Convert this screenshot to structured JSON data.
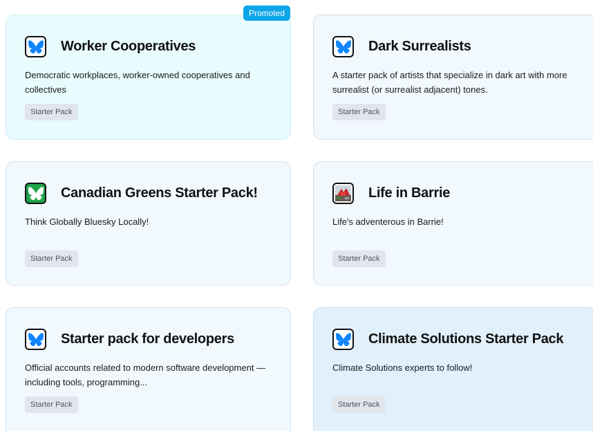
{
  "cards": [
    {
      "title": "Worker Cooperatives",
      "description": "Democratic workplaces, worker-owned cooperatives and collectives",
      "badge": "Starter Pack",
      "promoted_label": "Promoted",
      "icon": "butterfly-icon"
    },
    {
      "title": "Dark Surrealists",
      "description": "A starter pack of artists that specialize in dark art with more surrealist (or surrealist adjacent) tones.",
      "badge": "Starter Pack",
      "icon": "butterfly-icon"
    },
    {
      "title": "Canadian Greens Starter Pack!",
      "description": "Think Globally Bluesky Locally!",
      "badge": "Starter Pack",
      "icon": "green-butterfly-icon"
    },
    {
      "title": "Life in Barrie",
      "description": "Life's adventerous in Barrie!",
      "badge": "Starter Pack",
      "icon": "photo-avatar-icon"
    },
    {
      "title": "Starter pack for developers",
      "description": "Official accounts related to modern software development — including tools, programming...",
      "badge": "Starter Pack",
      "icon": "butterfly-icon"
    },
    {
      "title": "Climate Solutions Starter Pack",
      "description": "Climate Solutions experts to follow!",
      "badge": "Starter Pack",
      "icon": "butterfly-icon"
    }
  ],
  "colors": {
    "butterfly_blue": "#1185fe",
    "promoted_badge": "#0ea5e9",
    "card_bg": "#f1f8fe",
    "promoted_card_bg": "#e8fbfd",
    "hovered_card_bg": "#e2f0fb"
  }
}
